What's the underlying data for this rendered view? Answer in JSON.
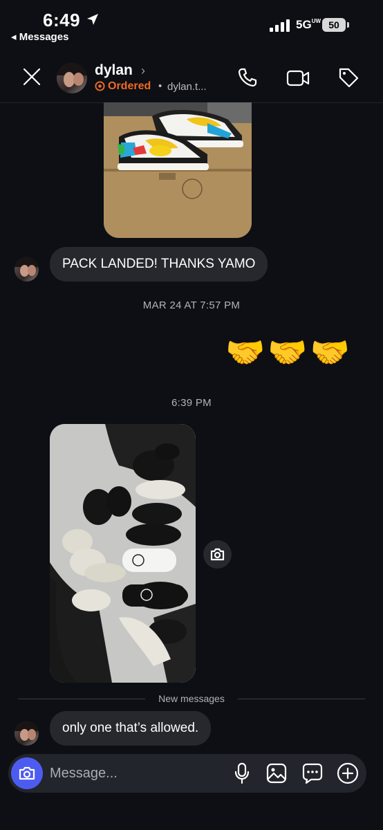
{
  "status_bar": {
    "time": "6:49",
    "back_app": "◂ Messages",
    "network": "5G",
    "network_sup": "UW",
    "battery": "50"
  },
  "header": {
    "name": "dylan",
    "status": "Ordered",
    "handle": "dylan.t..."
  },
  "messages": {
    "pack_landed": "PACK LANDED! THANKS YAMO",
    "timestamp_1": "MAR 24 AT 7:57 PM",
    "handshakes": "🤝🤝🤝",
    "timestamp_2": "6:39 PM",
    "new_messages_label": "New messages",
    "last_message": "only one that’s allowed."
  },
  "composer": {
    "placeholder": "Message..."
  }
}
